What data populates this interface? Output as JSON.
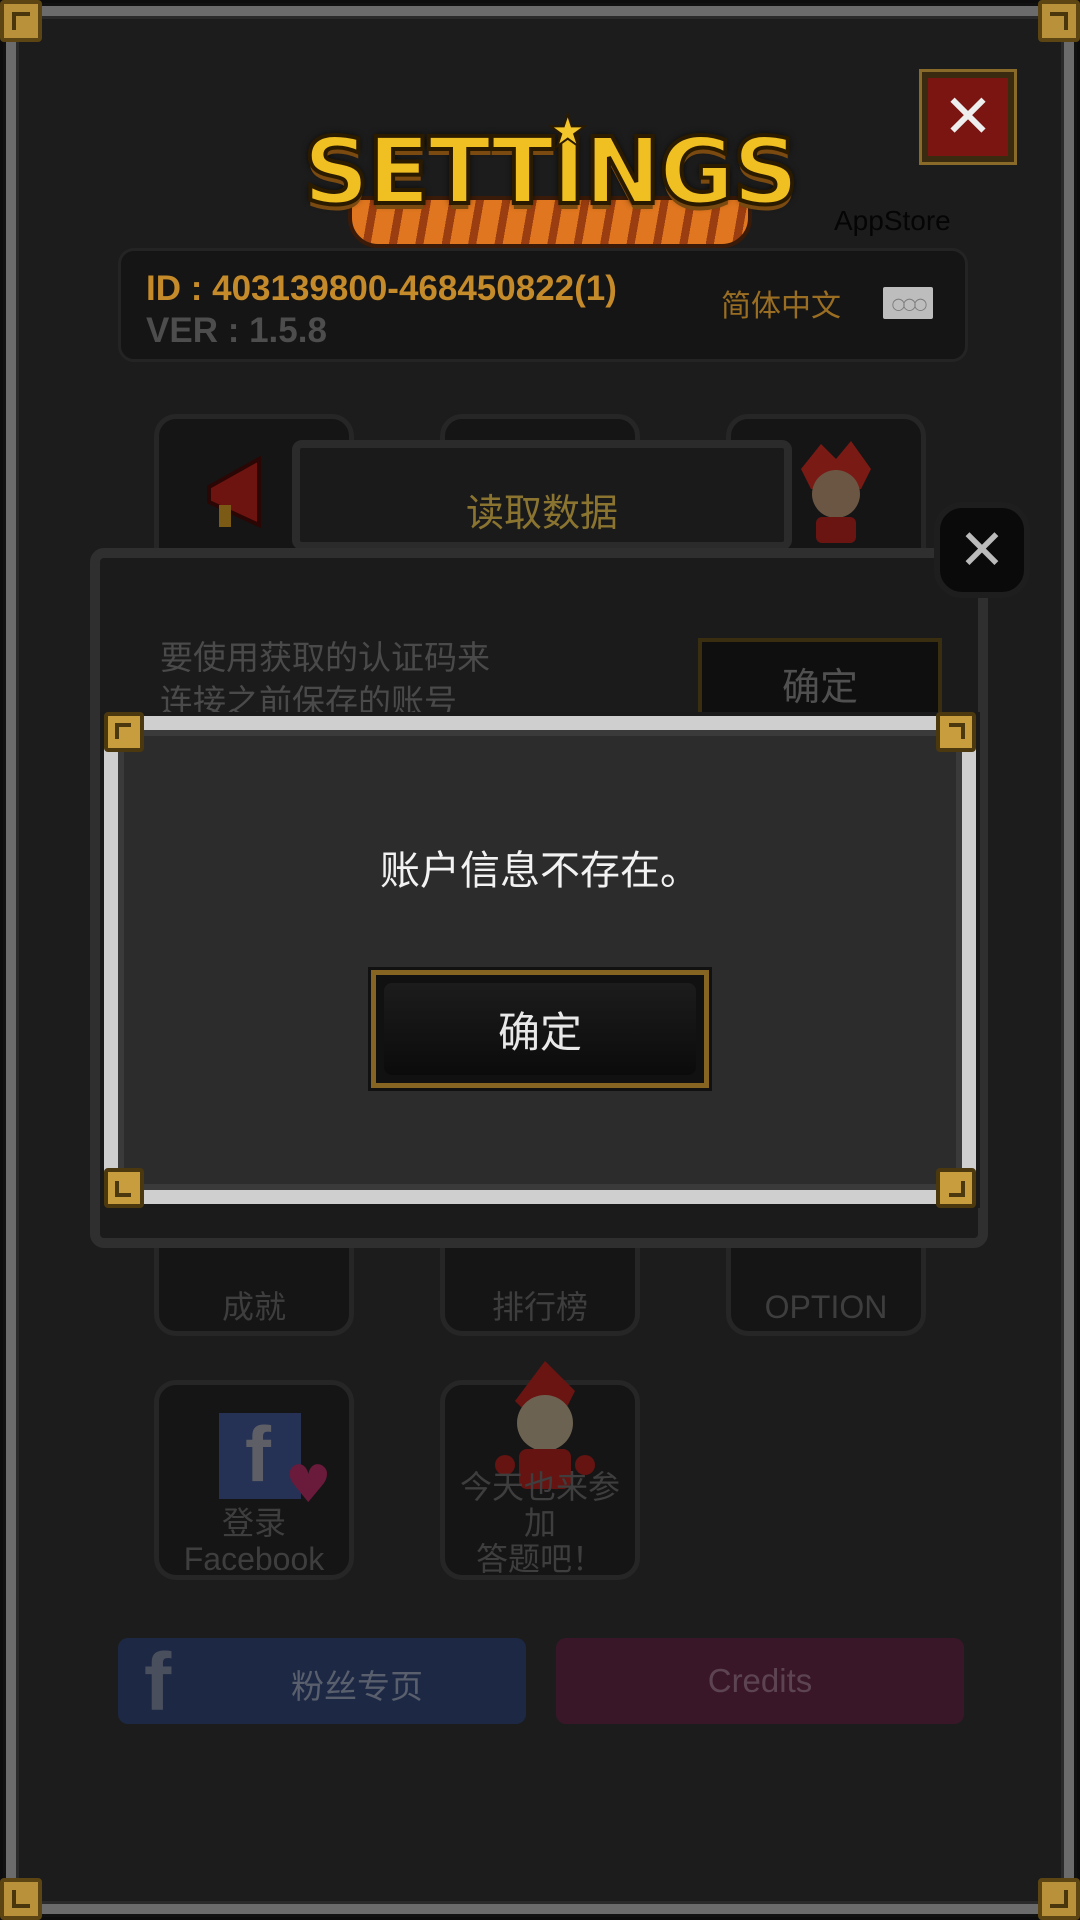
{
  "header": {
    "logo_text": "SETTINGS",
    "store_label": "AppStore",
    "close_symbol": "✕"
  },
  "info": {
    "id": "ID : 403139800-468450822(1)",
    "version": "VER : 1.5.8",
    "language": "简体中文",
    "flag_icon": "olympic-rings-icon"
  },
  "tiles": [
    {
      "label": "成就",
      "icon": "trophy-icon"
    },
    {
      "label": "排行榜",
      "icon": "leaderboard-icon"
    },
    {
      "label": "OPTION",
      "icon": "gear-icon"
    },
    {
      "label": "登录\nFacebook",
      "icon": "facebook-heart-icon"
    },
    {
      "label": "今天也来参加\n答题吧！",
      "icon": "elf-character-icon"
    }
  ],
  "bottom": {
    "fan_page": "粉丝专页",
    "fb_letter": "f",
    "credits": "Credits"
  },
  "load_dialog": {
    "title": "读取数据",
    "description_line1": "要使用获取的认证码来",
    "description_line2": "连接之前保存的账号",
    "confirm": "确定",
    "close_symbol": "✕"
  },
  "alert": {
    "message": "账户信息不存在。",
    "ok": "确定"
  },
  "colors": {
    "accent_gold": "#c58a2a",
    "alert_bg": "#2c2c2c",
    "close_red": "#7a1512"
  }
}
